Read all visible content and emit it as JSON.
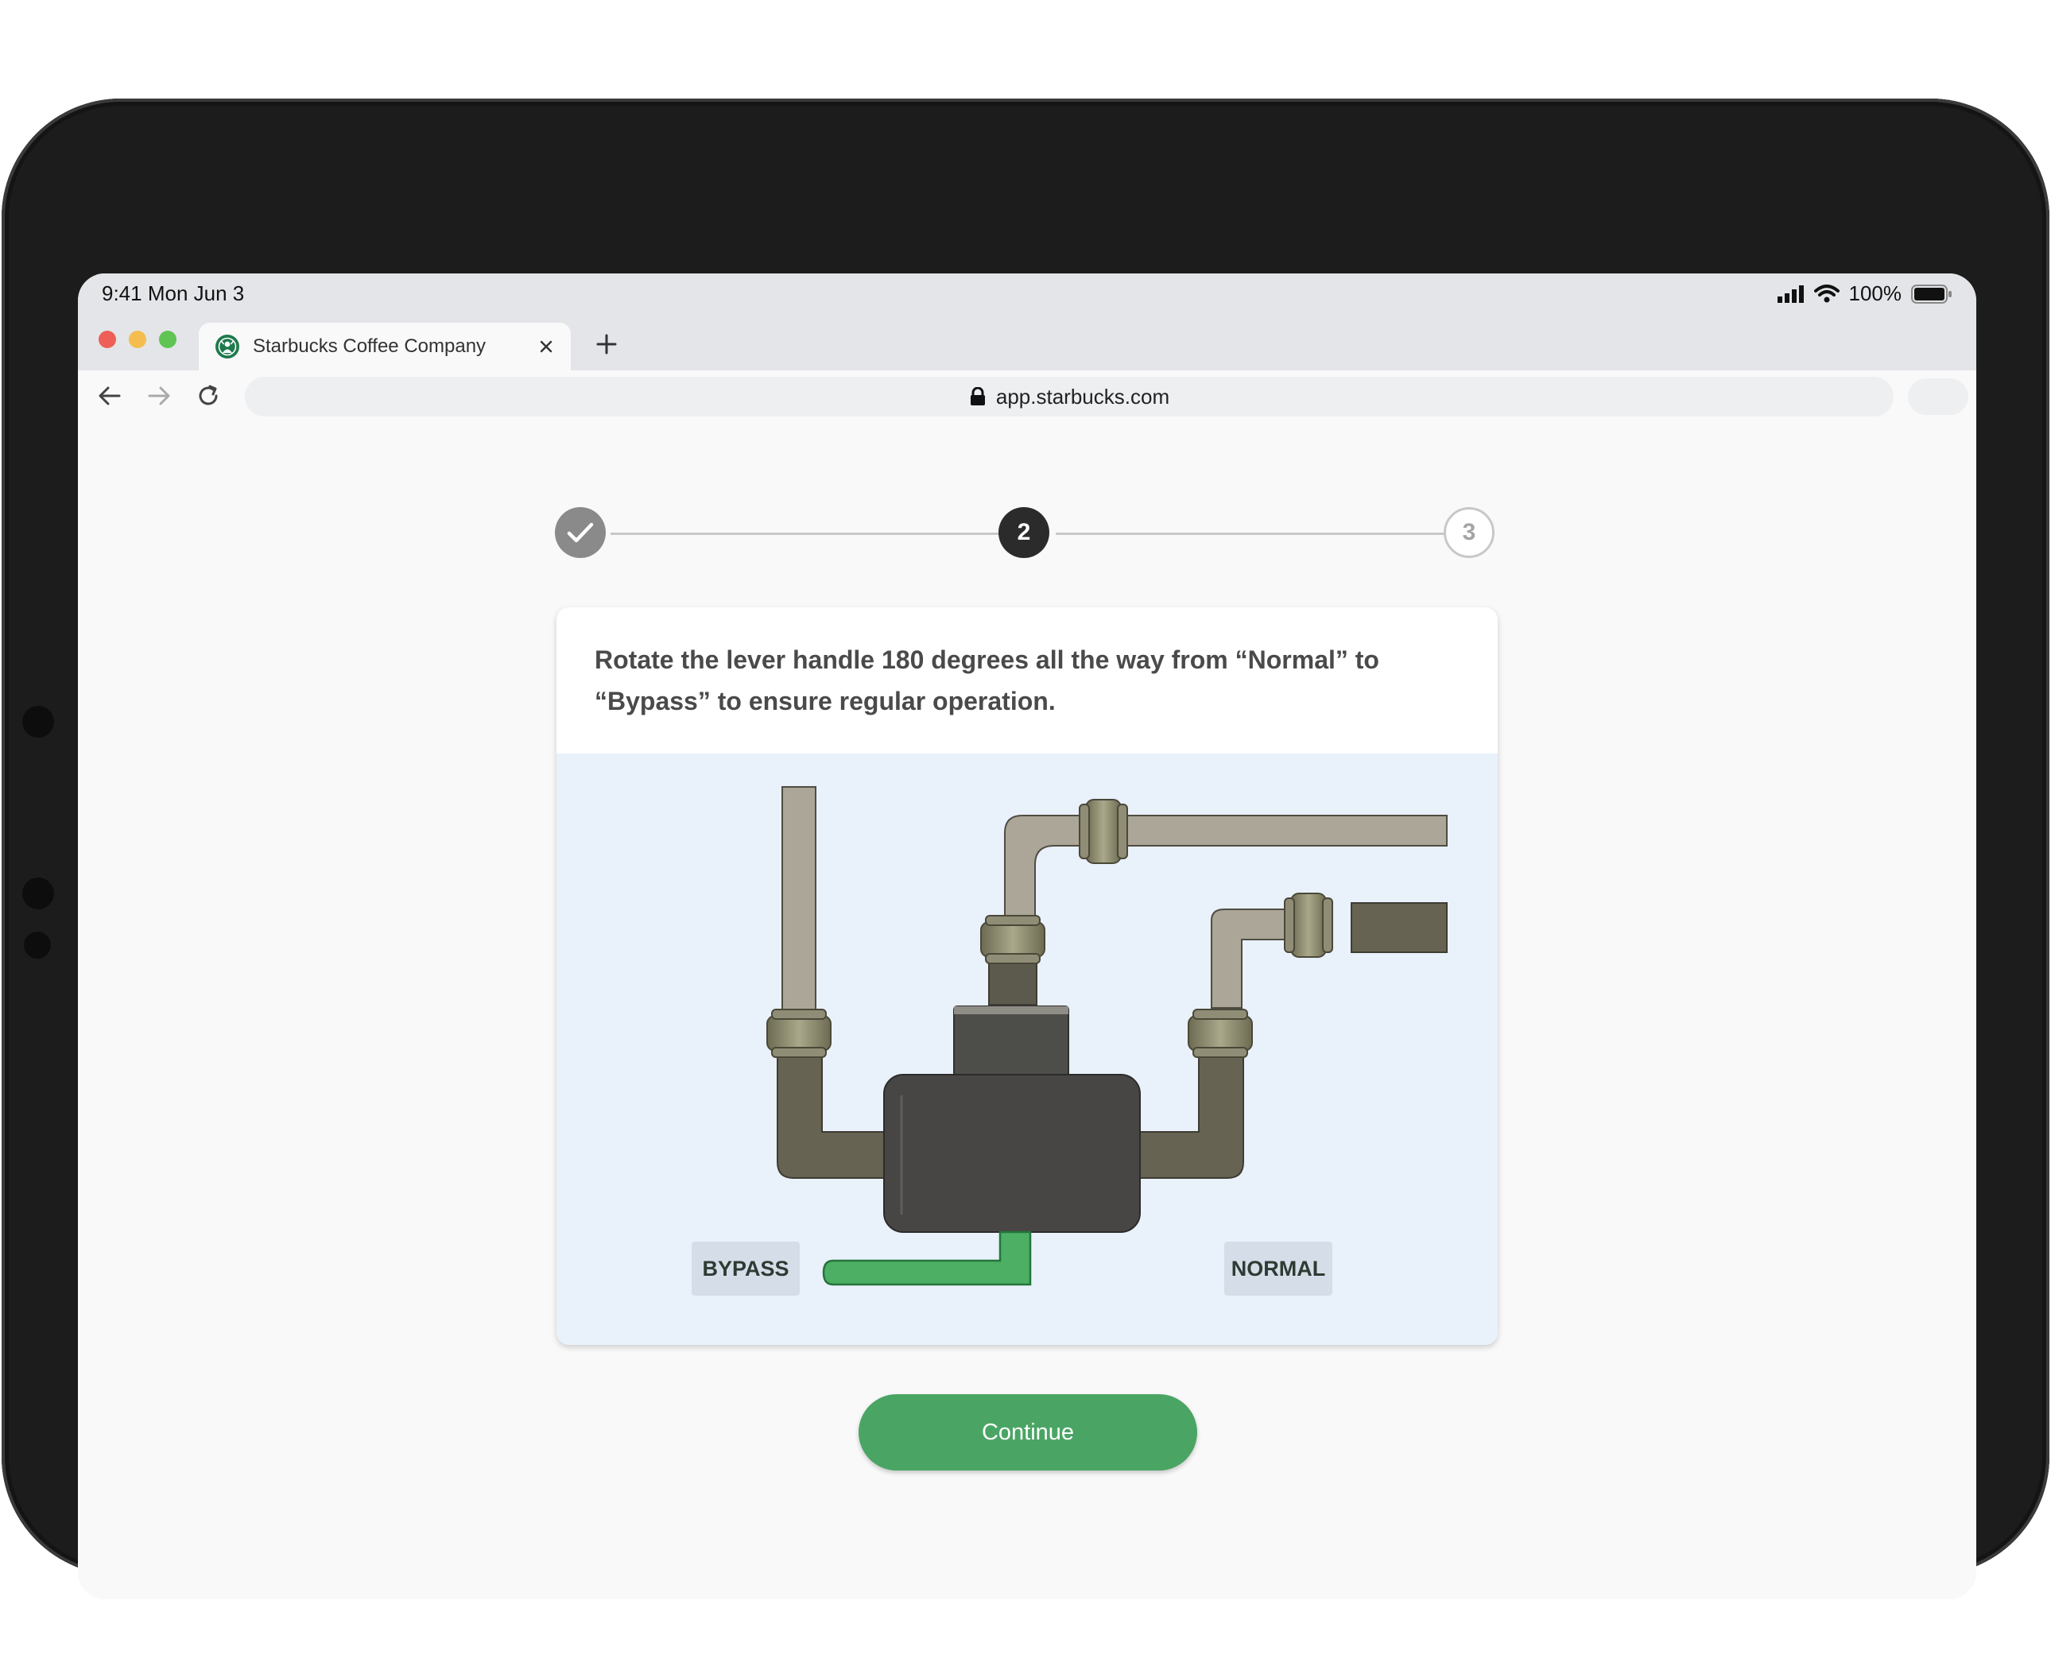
{
  "status_bar": {
    "time": "9:41  Mon Jun 3",
    "battery": "100%"
  },
  "browser": {
    "tab_title": "Starbucks Coffee Company",
    "url": "app.starbucks.com"
  },
  "stepper": {
    "steps": [
      {
        "label": "",
        "state": "completed"
      },
      {
        "label": "2",
        "state": "current"
      },
      {
        "label": "3",
        "state": "upcoming"
      }
    ]
  },
  "card": {
    "instruction": "Rotate the lever handle 180 degrees all the way from “Normal” to “Bypass” to ensure regular operation.",
    "label_bypass": "BYPASS",
    "label_normal": "NORMAL"
  },
  "continue_label": "Continue",
  "colors": {
    "accent_green": "#4aa564",
    "lever_green": "#4caf64",
    "step_done": "#8a8a8a",
    "step_current": "#2b2b2b"
  },
  "icons": [
    "checkmark-icon",
    "starbucks-favicon",
    "close-icon",
    "plus-icon",
    "back-arrow-icon",
    "forward-arrow-icon",
    "reload-icon",
    "lock-icon",
    "signal-icon",
    "wifi-icon",
    "battery-icon"
  ]
}
